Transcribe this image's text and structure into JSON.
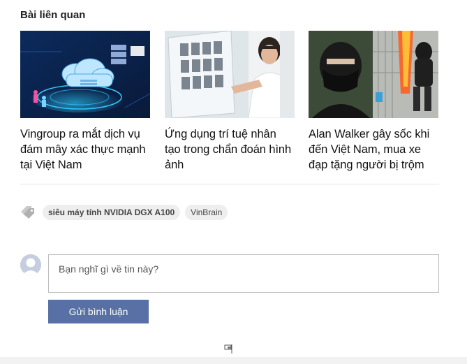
{
  "related": {
    "heading": "Bài liên quan",
    "articles": [
      {
        "title": "Vingroup ra mắt dịch vụ đám mây xác thực mạnh tại Việt Nam",
        "image": "cloud-illustration"
      },
      {
        "title": "Ứng dụng trí tuệ nhân tạo trong chẩn đoán hình ảnh",
        "image": "doctor-xray-photo"
      },
      {
        "title": "Alan Walker gây sốc khi đến Việt Nam, mua xe đạp tặng người bị trộm",
        "image": "masked-man-photo"
      }
    ]
  },
  "tags": {
    "icon": "tag-icon",
    "items": [
      {
        "label": "siêu máy tính NVIDIA DGX A100",
        "bold": true
      },
      {
        "label": "VinBrain",
        "bold": false
      }
    ]
  },
  "comment": {
    "placeholder": "Bạn nghĩ gì về tin này?",
    "submit_label": "Gửi bình luận"
  },
  "colors": {
    "button": "#5870a6",
    "tag_bg": "#eeeeee"
  }
}
